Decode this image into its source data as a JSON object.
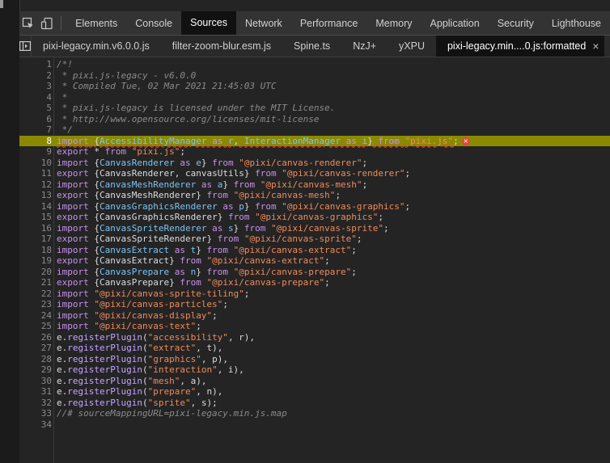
{
  "toolbar": {
    "tabs": [
      {
        "label": "Elements",
        "active": false
      },
      {
        "label": "Console",
        "active": false
      },
      {
        "label": "Sources",
        "active": true
      },
      {
        "label": "Network",
        "active": false
      },
      {
        "label": "Performance",
        "active": false
      },
      {
        "label": "Memory",
        "active": false
      },
      {
        "label": "Application",
        "active": false
      },
      {
        "label": "Security",
        "active": false
      },
      {
        "label": "Lighthouse",
        "active": false
      }
    ],
    "icons": [
      "inspect-element-icon",
      "device-toggle-icon"
    ]
  },
  "files": {
    "tabs": [
      {
        "label": "pixi-legacy.min.v6.0.0.js",
        "active": false
      },
      {
        "label": "filter-zoom-blur.esm.js",
        "active": false
      },
      {
        "label": "Spine.ts",
        "active": false
      },
      {
        "label": "NzJ+",
        "active": false
      },
      {
        "label": "yXPU",
        "active": false
      },
      {
        "label": "pixi-legacy.min....0.js:formatted",
        "active": true
      }
    ],
    "close_label": "×",
    "more_label": "»"
  },
  "editor": {
    "highlighted_line": 8,
    "error_badge": "×",
    "lines": [
      {
        "n": "1",
        "t": [
          [
            "com",
            "/*!"
          ]
        ]
      },
      {
        "n": "2",
        "t": [
          [
            "com",
            " * pixi.js-legacy - v6.0.0"
          ]
        ]
      },
      {
        "n": "3",
        "t": [
          [
            "com",
            " * Compiled Tue, 02 Mar 2021 21:45:03 UTC"
          ]
        ]
      },
      {
        "n": "4",
        "t": [
          [
            "com",
            " *"
          ]
        ]
      },
      {
        "n": "5",
        "t": [
          [
            "com",
            " * pixi.js-legacy is licensed under the MIT License."
          ]
        ]
      },
      {
        "n": "6",
        "t": [
          [
            "com",
            " * http://www.opensource.org/licenses/mit-license"
          ]
        ]
      },
      {
        "n": "7",
        "t": [
          [
            "com",
            " */"
          ]
        ]
      },
      {
        "n": "8",
        "t": [
          [
            "kw",
            "import"
          ],
          [
            "pl",
            " {"
          ],
          [
            "var",
            "AccessibilityManager"
          ],
          [
            "kw",
            " as "
          ],
          [
            "var",
            "r"
          ],
          [
            "pl",
            ", "
          ],
          [
            "var",
            "InteractionManager"
          ],
          [
            "kw",
            " as "
          ],
          [
            "var",
            "i"
          ],
          [
            "pl",
            "} "
          ],
          [
            "kw",
            "from "
          ],
          [
            "str",
            "\"pixi.js\""
          ],
          [
            "pl",
            ";"
          ]
        ]
      },
      {
        "n": "9",
        "t": [
          [
            "kw",
            "export"
          ],
          [
            "pl",
            " * "
          ],
          [
            "kw",
            "from "
          ],
          [
            "str",
            "\"pixi.js\""
          ],
          [
            "pl",
            ";"
          ]
        ]
      },
      {
        "n": "10",
        "t": [
          [
            "kw",
            "import"
          ],
          [
            "pl",
            " {"
          ],
          [
            "var",
            "CanvasRenderer"
          ],
          [
            "kw",
            " as "
          ],
          [
            "var",
            "e"
          ],
          [
            "pl",
            "} "
          ],
          [
            "kw",
            "from "
          ],
          [
            "str",
            "\"@pixi/canvas-renderer\""
          ],
          [
            "pl",
            ";"
          ]
        ]
      },
      {
        "n": "11",
        "t": [
          [
            "kw",
            "export"
          ],
          [
            "pl",
            " {"
          ],
          [
            "id",
            "CanvasRenderer"
          ],
          [
            "pl",
            ", "
          ],
          [
            "id",
            "canvasUtils"
          ],
          [
            "pl",
            "} "
          ],
          [
            "kw",
            "from "
          ],
          [
            "str",
            "\"@pixi/canvas-renderer\""
          ],
          [
            "pl",
            ";"
          ]
        ]
      },
      {
        "n": "12",
        "t": [
          [
            "kw",
            "import"
          ],
          [
            "pl",
            " {"
          ],
          [
            "var",
            "CanvasMeshRenderer"
          ],
          [
            "kw",
            " as "
          ],
          [
            "var",
            "a"
          ],
          [
            "pl",
            "} "
          ],
          [
            "kw",
            "from "
          ],
          [
            "str",
            "\"@pixi/canvas-mesh\""
          ],
          [
            "pl",
            ";"
          ]
        ]
      },
      {
        "n": "13",
        "t": [
          [
            "kw",
            "export"
          ],
          [
            "pl",
            " {"
          ],
          [
            "id",
            "CanvasMeshRenderer"
          ],
          [
            "pl",
            "} "
          ],
          [
            "kw",
            "from "
          ],
          [
            "str",
            "\"@pixi/canvas-mesh\""
          ],
          [
            "pl",
            ";"
          ]
        ]
      },
      {
        "n": "14",
        "t": [
          [
            "kw",
            "import"
          ],
          [
            "pl",
            " {"
          ],
          [
            "var",
            "CanvasGraphicsRenderer"
          ],
          [
            "kw",
            " as "
          ],
          [
            "var",
            "p"
          ],
          [
            "pl",
            "} "
          ],
          [
            "kw",
            "from "
          ],
          [
            "str",
            "\"@pixi/canvas-graphics\""
          ],
          [
            "pl",
            ";"
          ]
        ]
      },
      {
        "n": "15",
        "t": [
          [
            "kw",
            "export"
          ],
          [
            "pl",
            " {"
          ],
          [
            "id",
            "CanvasGraphicsRenderer"
          ],
          [
            "pl",
            "} "
          ],
          [
            "kw",
            "from "
          ],
          [
            "str",
            "\"@pixi/canvas-graphics\""
          ],
          [
            "pl",
            ";"
          ]
        ]
      },
      {
        "n": "16",
        "t": [
          [
            "kw",
            "import"
          ],
          [
            "pl",
            " {"
          ],
          [
            "var",
            "CanvasSpriteRenderer"
          ],
          [
            "kw",
            " as "
          ],
          [
            "var",
            "s"
          ],
          [
            "pl",
            "} "
          ],
          [
            "kw",
            "from "
          ],
          [
            "str",
            "\"@pixi/canvas-sprite\""
          ],
          [
            "pl",
            ";"
          ]
        ]
      },
      {
        "n": "17",
        "t": [
          [
            "kw",
            "export"
          ],
          [
            "pl",
            " {"
          ],
          [
            "id",
            "CanvasSpriteRenderer"
          ],
          [
            "pl",
            "} "
          ],
          [
            "kw",
            "from "
          ],
          [
            "str",
            "\"@pixi/canvas-sprite\""
          ],
          [
            "pl",
            ";"
          ]
        ]
      },
      {
        "n": "18",
        "t": [
          [
            "kw",
            "import"
          ],
          [
            "pl",
            " {"
          ],
          [
            "var",
            "CanvasExtract"
          ],
          [
            "kw",
            " as "
          ],
          [
            "var",
            "t"
          ],
          [
            "pl",
            "} "
          ],
          [
            "kw",
            "from "
          ],
          [
            "str",
            "\"@pixi/canvas-extract\""
          ],
          [
            "pl",
            ";"
          ]
        ]
      },
      {
        "n": "19",
        "t": [
          [
            "kw",
            "export"
          ],
          [
            "pl",
            " {"
          ],
          [
            "id",
            "CanvasExtract"
          ],
          [
            "pl",
            "} "
          ],
          [
            "kw",
            "from "
          ],
          [
            "str",
            "\"@pixi/canvas-extract\""
          ],
          [
            "pl",
            ";"
          ]
        ]
      },
      {
        "n": "20",
        "t": [
          [
            "kw",
            "import"
          ],
          [
            "pl",
            " {"
          ],
          [
            "var",
            "CanvasPrepare"
          ],
          [
            "kw",
            " as "
          ],
          [
            "var",
            "n"
          ],
          [
            "pl",
            "} "
          ],
          [
            "kw",
            "from "
          ],
          [
            "str",
            "\"@pixi/canvas-prepare\""
          ],
          [
            "pl",
            ";"
          ]
        ]
      },
      {
        "n": "21",
        "t": [
          [
            "kw",
            "export"
          ],
          [
            "pl",
            " {"
          ],
          [
            "id",
            "CanvasPrepare"
          ],
          [
            "pl",
            "} "
          ],
          [
            "kw",
            "from "
          ],
          [
            "str",
            "\"@pixi/canvas-prepare\""
          ],
          [
            "pl",
            ";"
          ]
        ]
      },
      {
        "n": "22",
        "t": [
          [
            "kw",
            "import "
          ],
          [
            "str",
            "\"@pixi/canvas-sprite-tiling\""
          ],
          [
            "pl",
            ";"
          ]
        ]
      },
      {
        "n": "23",
        "t": [
          [
            "kw",
            "import "
          ],
          [
            "str",
            "\"@pixi/canvas-particles\""
          ],
          [
            "pl",
            ";"
          ]
        ]
      },
      {
        "n": "24",
        "t": [
          [
            "kw",
            "import "
          ],
          [
            "str",
            "\"@pixi/canvas-display\""
          ],
          [
            "pl",
            ";"
          ]
        ]
      },
      {
        "n": "25",
        "t": [
          [
            "kw",
            "import "
          ],
          [
            "str",
            "\"@pixi/canvas-text\""
          ],
          [
            "pl",
            ";"
          ]
        ]
      },
      {
        "n": "26",
        "t": [
          [
            "id",
            "e"
          ],
          [
            "pl",
            "."
          ],
          [
            "fn",
            "registerPlugin"
          ],
          [
            "pl",
            "("
          ],
          [
            "str",
            "\"accessibility\""
          ],
          [
            "pl",
            ", r),"
          ]
        ]
      },
      {
        "n": "27",
        "t": [
          [
            "id",
            "e"
          ],
          [
            "pl",
            "."
          ],
          [
            "fn",
            "registerPlugin"
          ],
          [
            "pl",
            "("
          ],
          [
            "str",
            "\"extract\""
          ],
          [
            "pl",
            ", t),"
          ]
        ]
      },
      {
        "n": "28",
        "t": [
          [
            "id",
            "e"
          ],
          [
            "pl",
            "."
          ],
          [
            "fn",
            "registerPlugin"
          ],
          [
            "pl",
            "("
          ],
          [
            "str",
            "\"graphics\""
          ],
          [
            "pl",
            ", p),"
          ]
        ]
      },
      {
        "n": "29",
        "t": [
          [
            "id",
            "e"
          ],
          [
            "pl",
            "."
          ],
          [
            "fn",
            "registerPlugin"
          ],
          [
            "pl",
            "("
          ],
          [
            "str",
            "\"interaction\""
          ],
          [
            "pl",
            ", i),"
          ]
        ]
      },
      {
        "n": "30",
        "t": [
          [
            "id",
            "e"
          ],
          [
            "pl",
            "."
          ],
          [
            "fn",
            "registerPlugin"
          ],
          [
            "pl",
            "("
          ],
          [
            "str",
            "\"mesh\""
          ],
          [
            "pl",
            ", a),"
          ]
        ]
      },
      {
        "n": "31",
        "t": [
          [
            "id",
            "e"
          ],
          [
            "pl",
            "."
          ],
          [
            "fn",
            "registerPlugin"
          ],
          [
            "pl",
            "("
          ],
          [
            "str",
            "\"prepare\""
          ],
          [
            "pl",
            ", n),"
          ]
        ]
      },
      {
        "n": "32",
        "t": [
          [
            "id",
            "e"
          ],
          [
            "pl",
            "."
          ],
          [
            "fn",
            "registerPlugin"
          ],
          [
            "pl",
            "("
          ],
          [
            "str",
            "\"sprite\""
          ],
          [
            "pl",
            ", s);"
          ]
        ]
      },
      {
        "n": "33",
        "t": [
          [
            "com",
            "//# sourceMappingURL=pixi-legacy.min.js.map"
          ]
        ]
      },
      {
        "n": "34",
        "t": []
      }
    ]
  }
}
